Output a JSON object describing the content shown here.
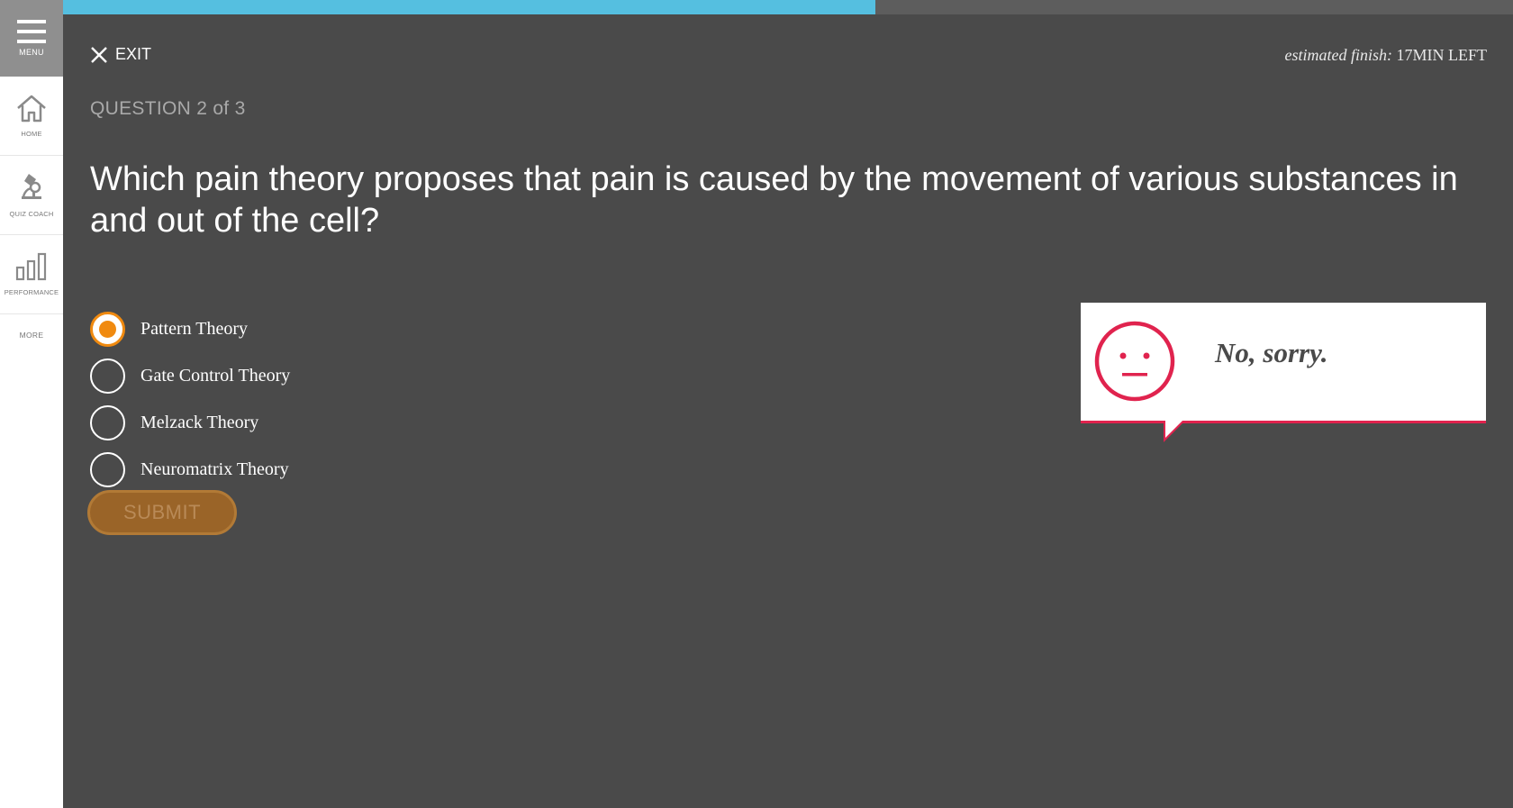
{
  "sidebar": {
    "menu_label": "MENU",
    "items": [
      {
        "label": "HOME",
        "icon": "home-icon"
      },
      {
        "label": "QUIZ COACH",
        "icon": "microscope-icon"
      },
      {
        "label": "PERFORMANCE",
        "icon": "bar-chart-icon"
      }
    ],
    "more_label": "MORE"
  },
  "progress": {
    "fraction": 0.56,
    "fill_color": "#55bfe0",
    "track_color": "#5d5d5d"
  },
  "header": {
    "exit_label": "EXIT",
    "finish_prefix": "estimated finish:",
    "finish_value": "17MIN LEFT"
  },
  "quiz": {
    "question_count": "QUESTION 2 of 3",
    "question": "Which pain theory proposes that pain is caused by the movement of various substances in and out of the cell?",
    "options": [
      {
        "label": "Pattern Theory",
        "selected": true
      },
      {
        "label": "Gate Control Theory",
        "selected": false
      },
      {
        "label": "Melzack Theory",
        "selected": false
      },
      {
        "label": "Neuromatrix Theory",
        "selected": false
      }
    ],
    "submit_label": "SUBMIT"
  },
  "feedback": {
    "message": "No, sorry.",
    "icon": "neutral-face-icon",
    "accent_color": "#e0234e"
  },
  "colors": {
    "background": "#4a4a4a",
    "selected_accent": "#f08a10",
    "submit_bg": "#9a6428"
  }
}
